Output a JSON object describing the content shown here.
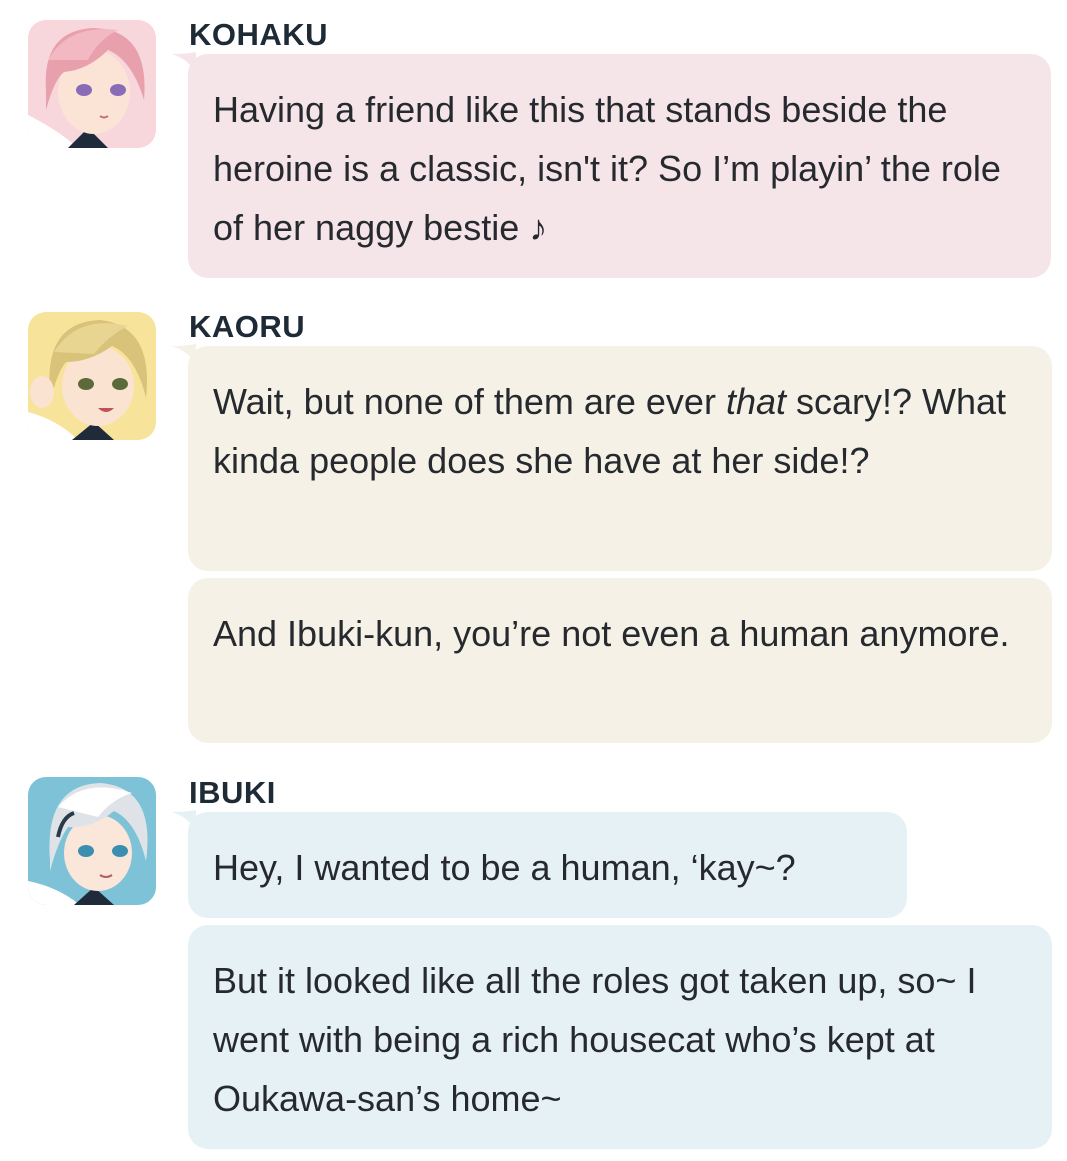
{
  "colors": {
    "kohaku_bubble": "#f5e4e8",
    "kaoru_bubble": "#f5f1e6",
    "ibuki_bubble": "#e6f1f6",
    "speaker_text": "#1e2a35",
    "message_text": "#262a2e"
  },
  "messages": [
    {
      "speaker": "KOHAKU",
      "avatar": "kohaku-avatar",
      "lines": [
        "Having a friend like this that stands beside the heroine is a classic, isn't it? So I’m playin’ the role of her naggy bestie ♪"
      ]
    },
    {
      "speaker": "KAORU",
      "avatar": "kaoru-avatar",
      "lines": [
        {
          "before": "Wait, but none of them are ever ",
          "emphasis": "that",
          "after": " scary!? What kinda people does she have at her side!?"
        },
        "And Ibuki-kun, you’re not even a human anymore."
      ]
    },
    {
      "speaker": "IBUKI",
      "avatar": "ibuki-avatar",
      "lines": [
        "Hey, I wanted to be a human, ‘kay~?",
        "But it looked like all the roles got taken up, so~ I went with being a rich housecat who’s kept at Oukawa-san’s home~"
      ]
    }
  ]
}
